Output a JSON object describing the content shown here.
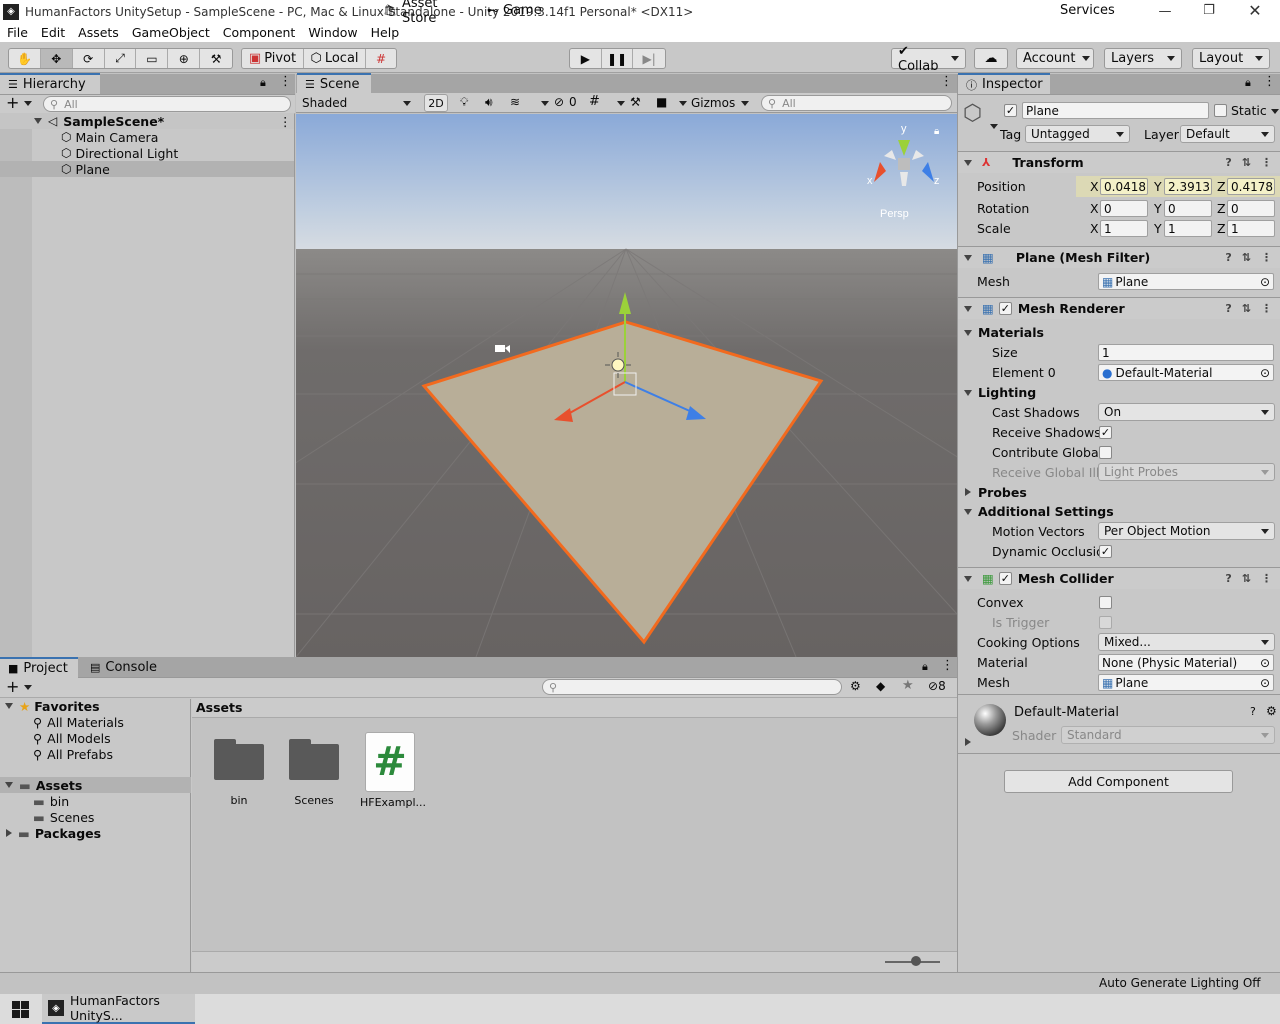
{
  "window": {
    "title": "HumanFactors UnitySetup - SampleScene - PC, Mac & Linux Standalone - Unity 2019.3.14f1 Personal* <DX11>"
  },
  "menu": [
    "File",
    "Edit",
    "Assets",
    "GameObject",
    "Component",
    "Window",
    "Help"
  ],
  "toolbar": {
    "pivot": "Pivot",
    "local": "Local",
    "collab": "Collab",
    "account": "Account",
    "layers": "Layers",
    "layout": "Layout"
  },
  "hierarchy": {
    "tab": "Hierarchy",
    "search_placeholder": "All",
    "scene": "SampleScene*",
    "items": [
      "Main Camera",
      "Directional Light",
      "Plane"
    ]
  },
  "scene_view": {
    "tabs": [
      "Scene",
      "Asset Store",
      "Game"
    ],
    "shading": "Shaded",
    "mode_2d": "2D",
    "hidden_count": "0",
    "gizmos": "Gizmos",
    "search_placeholder": "All",
    "axis_y": "y",
    "axis_x": "x",
    "axis_z": "z",
    "projection": "Persp"
  },
  "project": {
    "tabs": [
      "Project",
      "Console"
    ],
    "hidden_count": "8",
    "favorites_label": "Favorites",
    "favorites": [
      "All Materials",
      "All Models",
      "All Prefabs"
    ],
    "assets_label": "Assets",
    "asset_folders": [
      "bin",
      "Scenes"
    ],
    "packages_label": "Packages",
    "breadcrumb": "Assets",
    "grid_items": [
      "bin",
      "Scenes",
      "HFExampl..."
    ],
    "script_glyph": "#"
  },
  "inspector": {
    "tabs": [
      "Inspector",
      "Services"
    ],
    "object_name": "Plane",
    "static_label": "Static",
    "tag_label": "Tag",
    "tag_value": "Untagged",
    "layer_label": "Layer",
    "layer_value": "Default",
    "transform": {
      "title": "Transform",
      "position_label": "Position",
      "rotation_label": "Rotation",
      "scale_label": "Scale",
      "position": [
        "0.0418",
        "2.3913",
        "0.4178"
      ],
      "rotation": [
        "0",
        "0",
        "0"
      ],
      "scale": [
        "1",
        "1",
        "1"
      ],
      "axes": [
        "X",
        "Y",
        "Z"
      ]
    },
    "mesh_filter": {
      "title": "Plane (Mesh Filter)",
      "mesh_label": "Mesh",
      "mesh_value": "Plane"
    },
    "mesh_renderer": {
      "title": "Mesh Renderer",
      "materials_label": "Materials",
      "size_label": "Size",
      "size_value": "1",
      "element0_label": "Element 0",
      "element0_value": "Default-Material",
      "lighting_label": "Lighting",
      "cast_shadows_label": "Cast Shadows",
      "cast_shadows_value": "On",
      "receive_shadows_label": "Receive Shadows",
      "contribute_gi_label": "Contribute Global I",
      "receive_gi_label": "Receive Global Illu",
      "receive_gi_value": "Light Probes",
      "probes_label": "Probes",
      "additional_label": "Additional Settings",
      "motion_vectors_label": "Motion Vectors",
      "motion_vectors_value": "Per Object Motion",
      "dynamic_occlusion_label": "Dynamic Occlusio"
    },
    "mesh_collider": {
      "title": "Mesh Collider",
      "convex_label": "Convex",
      "is_trigger_label": "Is Trigger",
      "cooking_label": "Cooking Options",
      "cooking_value": "Mixed...",
      "material_label": "Material",
      "material_value": "None (Physic Material)",
      "mesh_label": "Mesh",
      "mesh_value": "Plane"
    },
    "material": {
      "name": "Default-Material",
      "shader_label": "Shader",
      "shader_value": "Standard"
    },
    "add_component": "Add Component"
  },
  "status": {
    "lighting": "Auto Generate Lighting Off"
  },
  "taskbar": {
    "app": "HumanFactors UnityS..."
  },
  "colors": {
    "accent": "#3a72b0",
    "selection_orange": "#f26a1e",
    "plane_fill": "#b8ae98",
    "ground": "#6e6b6b",
    "sky_top": "#8aa9d8"
  }
}
